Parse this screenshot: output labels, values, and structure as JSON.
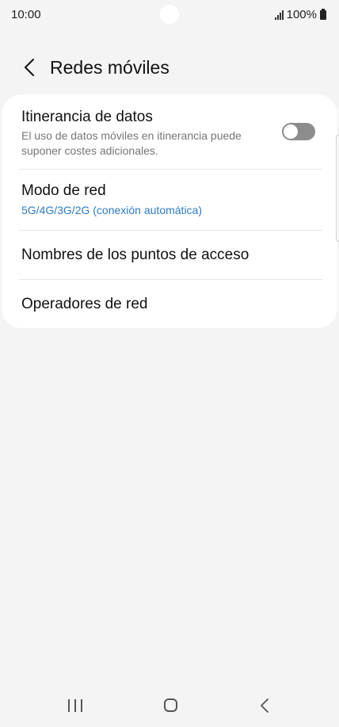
{
  "status_bar": {
    "time": "10:00",
    "battery": "100%"
  },
  "header": {
    "title": "Redes móviles"
  },
  "settings": {
    "roaming": {
      "title": "Itinerancia de datos",
      "subtitle": "El uso de datos móviles en itinerancia puede suponer costes adicionales.",
      "enabled": false
    },
    "network_mode": {
      "title": "Modo de red",
      "value": "5G/4G/3G/2G (conexión automática)"
    },
    "apn": {
      "title": "Nombres de los puntos de acceso"
    },
    "operators": {
      "title": "Operadores de red"
    }
  },
  "colors": {
    "accent": "#2f7bc4",
    "background": "#f4f4f4",
    "card": "#ffffff",
    "toggle_off": "#8c8c8c"
  }
}
